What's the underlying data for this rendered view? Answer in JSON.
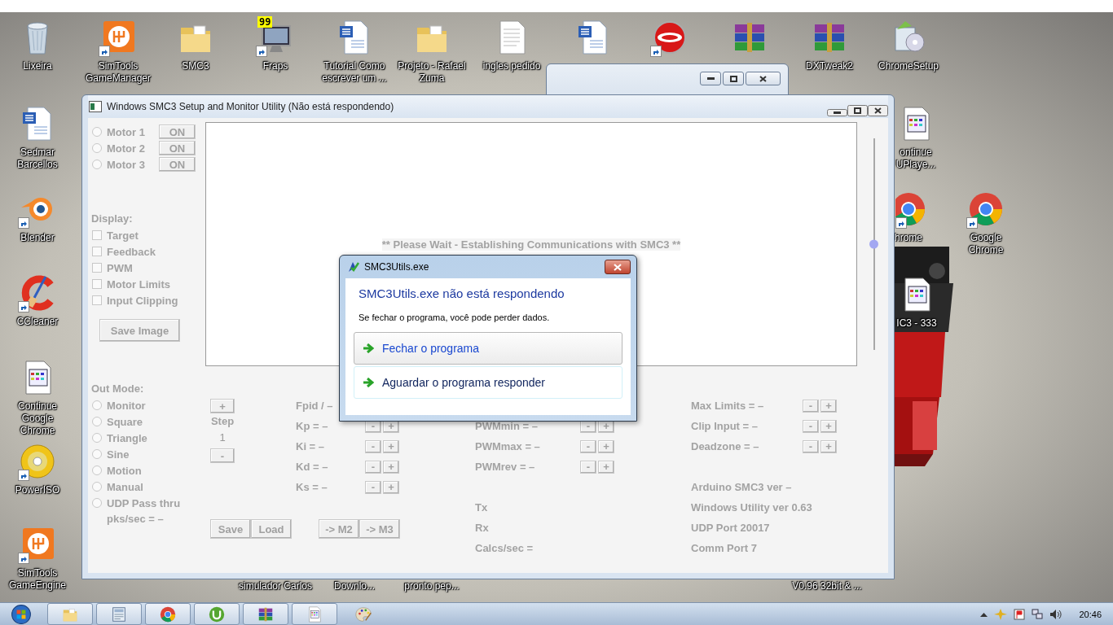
{
  "desktop": {
    "icons": [
      {
        "label": "Lixeira",
        "kind": "recycle-bin",
        "shortcut": false
      },
      {
        "label": "SimTools GameManager",
        "kind": "simtools",
        "shortcut": true
      },
      {
        "label": "SMC3",
        "kind": "folder",
        "shortcut": false
      },
      {
        "label": "Fraps",
        "kind": "monitor",
        "badge": "99",
        "shortcut": true
      },
      {
        "label": "Tutorial Como escrever um ...",
        "kind": "word",
        "shortcut": false
      },
      {
        "label": "Projeto - Rafael Zuma",
        "kind": "folder",
        "shortcut": false
      },
      {
        "label": "ingles pedido",
        "kind": "text-file",
        "shortcut": false
      },
      {
        "kind": "word",
        "shortcut": false
      },
      {
        "kind": "nero",
        "shortcut": true
      },
      {
        "kind": "winrar",
        "shortcut": false
      },
      {
        "label": "DXTweak2",
        "kind": "winrar",
        "shortcut": false
      },
      {
        "label": "ChromeSetup",
        "kind": "installer",
        "shortcut": false
      },
      {
        "label": "Sedmar Barcellos",
        "kind": "word",
        "shortcut": false
      },
      {
        "label": "Blender",
        "kind": "blender",
        "shortcut": true
      },
      {
        "label": "CCleaner",
        "kind": "ccleaner",
        "shortcut": true
      },
      {
        "label": "Continue Google Chrome",
        "kind": "document",
        "shortcut": false
      },
      {
        "label": "PowerISO",
        "kind": "disc",
        "shortcut": true
      },
      {
        "label": "SimTools GameEngine",
        "kind": "simtools",
        "shortcut": true
      },
      {
        "label": "ontinue UPlaye...",
        "kind": "document",
        "shortcut": false
      },
      {
        "label": "hrome",
        "kind": "chrome",
        "shortcut": true
      },
      {
        "label": "Google Chrome",
        "kind": "chrome",
        "shortcut": true
      },
      {
        "label": "IC3 - 333",
        "kind": "document",
        "shortcut": false
      }
    ],
    "hidden_icon_labels": [
      "simulador Carlos",
      "Downlo...",
      "pronto pep...",
      "V0.96 32bit & ..."
    ]
  },
  "main_window": {
    "title": "Windows SMC3 Setup and Monitor Utility (Não está respondendo)",
    "motors": [
      {
        "label": "Motor 1",
        "selected": false,
        "button": "ON"
      },
      {
        "label": "Motor 2",
        "selected": false,
        "button": "ON"
      },
      {
        "label": "Motor 3",
        "selected": false,
        "button": "ON"
      }
    ],
    "display": {
      "label": "Display:",
      "options": [
        {
          "label": "Target",
          "checked": false
        },
        {
          "label": "Feedback",
          "checked": false
        },
        {
          "label": "PWM",
          "checked": false
        },
        {
          "label": "Motor Limits",
          "checked": false
        },
        {
          "label": "Input Clipping",
          "checked": false
        }
      ],
      "save_button": "Save Image"
    },
    "plot": {
      "message": "** Please Wait - Establishing Communications with SMC3 **"
    },
    "slider": {
      "level": 0.5
    },
    "out_mode": {
      "label": "Out Mode:",
      "options": [
        {
          "label": "Monitor",
          "selected": false
        },
        {
          "label": "Square",
          "selected": false
        },
        {
          "label": "Triangle",
          "selected": false
        },
        {
          "label": "Sine",
          "selected": false
        },
        {
          "label": "Motion",
          "selected": false
        },
        {
          "label": "Manual",
          "selected": false
        },
        {
          "label": "UDP Pass thru",
          "selected": false
        }
      ],
      "rate": "pks/sec = –"
    },
    "step": {
      "increase": "+",
      "label": "Step",
      "value": "1",
      "decrease": "-"
    },
    "pid": {
      "title": "Fpid / –",
      "params": [
        {
          "label": "Kp = –",
          "buttons": [
            "-",
            "+"
          ]
        },
        {
          "label": "Ki = –",
          "buttons": [
            "-",
            "+"
          ]
        },
        {
          "label": "Kd = –",
          "buttons": [
            "-",
            "+"
          ]
        },
        {
          "label": "Ks = –",
          "buttons": [
            "-",
            "+"
          ]
        }
      ]
    },
    "file_buttons": [
      "Save",
      "Load"
    ],
    "copy_buttons": [
      "-> M2",
      "-> M3"
    ],
    "pwm": {
      "params": [
        {
          "label": "PWMmin = –",
          "buttons": [
            "-",
            "+"
          ]
        },
        {
          "label": "PWMmax = –",
          "buttons": [
            "-",
            "+"
          ]
        },
        {
          "label": "PWMrev = –",
          "buttons": [
            "-",
            "+"
          ]
        }
      ],
      "stats": [
        "Tx",
        "Rx",
        "Calcs/sec ="
      ]
    },
    "limits": {
      "params": [
        {
          "label": "Max Limits = –",
          "buttons": [
            "-",
            "+"
          ]
        },
        {
          "label": "Clip Input = –",
          "buttons": [
            "-",
            "+"
          ]
        },
        {
          "label": "Deadzone = –",
          "buttons": [
            "-",
            "+"
          ]
        }
      ],
      "info": [
        "Arduino SMC3 ver –",
        "Windows Utility ver 0.63",
        "UDP Port 20017",
        "Comm Port 7"
      ]
    }
  },
  "dialog": {
    "title": "SMC3Utils.exe",
    "heading": "SMC3Utils.exe não está respondendo",
    "message": "Se fechar o programa, você pode perder dados.",
    "options": [
      {
        "label": "Fechar o programa",
        "selected": true
      },
      {
        "label": "Aguardar o programa responder",
        "selected": false
      }
    ]
  },
  "taskbar": {
    "items": [
      {
        "kind": "start",
        "running": false
      },
      {
        "kind": "folder",
        "running": true
      },
      {
        "kind": "window-app",
        "running": true
      },
      {
        "kind": "chrome",
        "running": true
      },
      {
        "kind": "torrent",
        "running": true
      },
      {
        "kind": "winrar",
        "running": true
      },
      {
        "kind": "document",
        "running": true
      },
      {
        "kind": "paint",
        "running": false
      }
    ],
    "clock": "20:46"
  }
}
